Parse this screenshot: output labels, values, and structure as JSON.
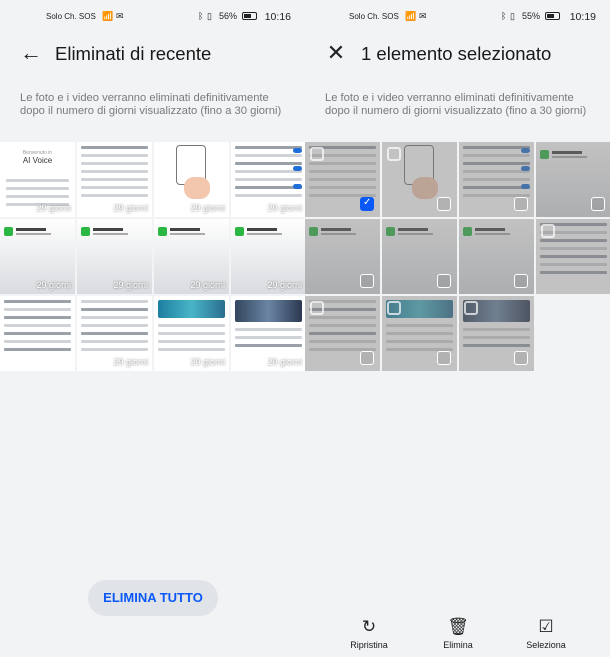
{
  "left": {
    "status": {
      "carrier": "Solo Ch. SOS",
      "battery": "56%",
      "time": "10:16"
    },
    "title": "Eliminati di recente",
    "description": "Le foto e i video verranno eliminati definitivamente dopo il numero di giorni visualizzato (fino a 30 giorni)",
    "days_label": "29 giorni",
    "tile1_caption_small": "AI Voice",
    "delete_all_label": "ELIMINA TUTTO"
  },
  "right": {
    "status": {
      "carrier": "Solo Ch. SOS",
      "battery": "55%",
      "time": "10:19"
    },
    "title": "1 elemento selezionato",
    "description": "Le foto e i video verranno eliminati definitivamente dopo il numero di giorni visualizzato (fino a 30 giorni)",
    "actions": {
      "restore": "Ripristina",
      "delete": "Elimina",
      "select": "Seleziona"
    }
  },
  "icons": {
    "back": "back-arrow-icon",
    "close": "close-icon",
    "restore": "restore-icon",
    "delete": "trash-icon",
    "select": "select-all-icon",
    "wifi": "wifi-icon",
    "bluetooth": "bluetooth-icon",
    "mail": "mail-icon",
    "vibrate": "vibrate-icon",
    "battery": "battery-icon"
  },
  "colors": {
    "accent": "#0a59f7",
    "background": "#f1f3f5",
    "button_bg": "#e0e3e8"
  }
}
